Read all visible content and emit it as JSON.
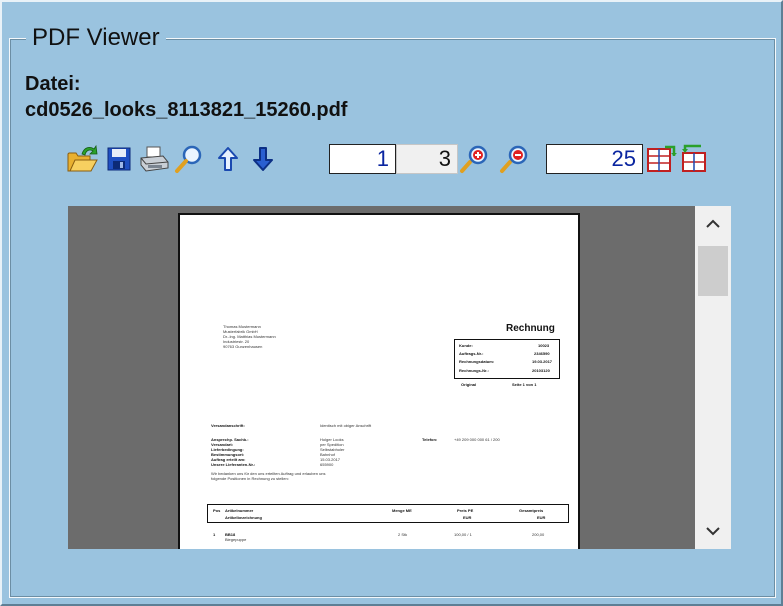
{
  "window": {
    "group_title": "PDF Viewer"
  },
  "file": {
    "label": "Datei:",
    "name": "cd0526_looks_8113821_15260.pdf"
  },
  "toolbar": {
    "current_page": "1",
    "page_count": "3",
    "zoom": "25"
  },
  "document": {
    "sender": [
      "Thomas Mustermann",
      "Musterfabrik GmbH",
      "Dr.-Ing. Matthias Mustermann",
      "Industriestr. 20",
      "90763 Gunzenhausen"
    ],
    "title": "Rechnung",
    "meta": [
      {
        "k": "Kunde:",
        "v": "10023"
      },
      {
        "k": "Auftrags-Nr.:",
        "v": "2346590"
      },
      {
        "k": "Rechnungsdatum:",
        "v": "19.03.2017"
      },
      {
        "k": "Rechnungs-Nr.:",
        "v": "20103120"
      }
    ],
    "original": "Original",
    "page_info": "Seite 1 von 1",
    "ship_label": "Versandanschrift:",
    "ship_value": "Identisch mit obiger Anschrift",
    "details": [
      {
        "k": "Ansprechp. Sachb.:",
        "v": "Holger Looks"
      },
      {
        "k": "Versandart:",
        "v": "per Spedition"
      },
      {
        "k": "Lieferbedingung:",
        "v": "Selbstabholer"
      },
      {
        "k": "Bestimmungsort:",
        "v": "Bahnhof"
      },
      {
        "k": "Auftrag erteilt am:",
        "v": "15.03.2017"
      },
      {
        "k": "Unsere Lieferanten-Nr.:",
        "v": "655900"
      }
    ],
    "phone_label": "Telefon:",
    "phone_value": "+49 209 000 000 61 / 200",
    "thanks": "Wir bedanken uns für den uns erteilten Auftrag und erlauben uns",
    "thanks2": "folgende Positionen in Rechnung zu stellen:",
    "table_head": {
      "pos": "Pos",
      "art": "Artikelnummer",
      "desc": "Artikelbezeichnung",
      "qty": "Menge ME",
      "price": "Preis PE",
      "total": "Gesamtpreis",
      "cur1": "EUR",
      "cur2": "EUR"
    },
    "row1": {
      "pos": "1",
      "art": "BB18",
      "desc": "Biegepuppe",
      "qty": "2 Stk",
      "price": "100,00 / 1",
      "total": "200,00"
    }
  }
}
